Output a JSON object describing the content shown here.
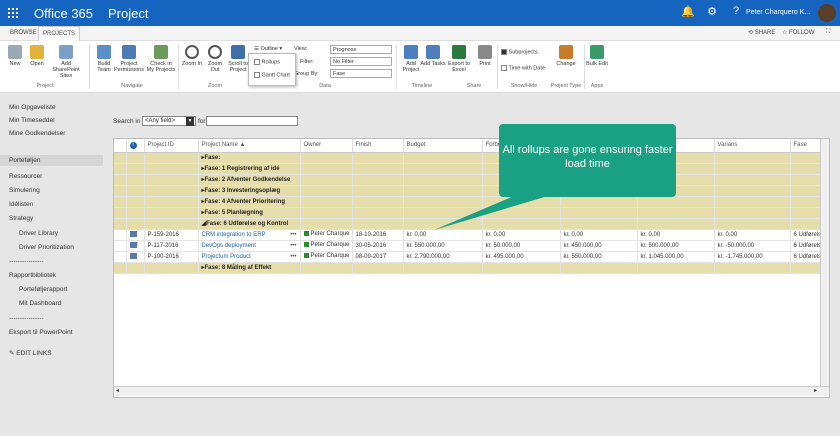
{
  "header": {
    "app": "Office 365",
    "site": "Project",
    "user": "Peter Charquero K..."
  },
  "tabs": [
    "BROWSE",
    "PROJECTS"
  ],
  "tabbar_actions": {
    "share": "SHARE",
    "follow": "FOLLOW"
  },
  "ribbon": {
    "buttons": {
      "new": "New",
      "open": "Open",
      "add_sites": "Add SharePoint Sites",
      "build_team": "Build Team",
      "permissions": "Project Permissions",
      "check_in": "Check in My Projects",
      "zoom_in": "Zoom In",
      "zoom_out": "Zoom Out",
      "scroll": "Scroll to Project",
      "add_project": "Add Project",
      "add_tasks": "Add Tasks",
      "export": "Export to Excel",
      "print": "Print",
      "change": "Change",
      "bulk_edit": "Bulk Edit"
    },
    "outline": "Outline",
    "rollups": "Rollups",
    "gantt": "Gantt Chart",
    "view_label": "View:",
    "view_value": "Prognose",
    "filter_label": "Filter:",
    "filter_value": "No Filter",
    "groupby_label": "Group By:",
    "groupby_value": "Fase",
    "subprojects": "Subprojects",
    "time_with_date": "Time with Date",
    "groups": {
      "project": "Project",
      "navigate": "Navigate",
      "zoom": "Zoom",
      "data": "Data",
      "timeline": "Timeline",
      "share": "Share",
      "showhide": "Show/Hide",
      "project_type": "Project Type",
      "apps": "Apps"
    }
  },
  "leftnav": [
    {
      "label": "Min Opgaveliste"
    },
    {
      "label": "Min Timeseddel"
    },
    {
      "label": "Mine Godkendelser"
    },
    {
      "label": "Porteføljen"
    },
    {
      "label": "Ressourcer"
    },
    {
      "label": "Simulering"
    },
    {
      "label": "Idélisten"
    },
    {
      "label": "Strategy"
    },
    {
      "label": "Driver Library"
    },
    {
      "label": "Driver Prioritization"
    },
    {
      "label": "----------------"
    },
    {
      "label": "Rapportbibliotek"
    },
    {
      "label": "Porteføljerapport"
    },
    {
      "label": "Mit Dashboard"
    },
    {
      "label": "----------------"
    },
    {
      "label": "Eksport til PowerPoint"
    },
    {
      "label": "EDIT LINKS"
    }
  ],
  "search": {
    "label": "Search in",
    "field": "<Any field>",
    "for": "for",
    "value": ""
  },
  "grid": {
    "columns": [
      "",
      "Project ID",
      "Project Name",
      "Owner",
      "Finish",
      "Budget",
      "Forbr",
      "",
      "",
      "Varians",
      "Fase"
    ],
    "phases": [
      "Fase:",
      "Fase: 1 Registrering af idé",
      "Fase: 2 Afventer Godkendelse",
      "Fase: 3 Investeringsoplæg",
      "Fase: 4 Afventer Prioritering",
      "Fase: 5 Planlægning",
      "Fase: 6 Udførelse og Kontrol",
      "Fase: 8 Måling af Effekt"
    ],
    "rows": [
      {
        "id": "P-159-2016",
        "name": "CRM integration to ERP",
        "owner": "Peter Charque",
        "finish": "18-10-2016",
        "budget": "kr. 0,00",
        "forbr": "kr. 0,00",
        "c7": "kr. 0,00",
        "c8": "kr. 0,00",
        "varians": "kr. 0,00",
        "fase": "6 Udførelse"
      },
      {
        "id": "P-117-2016",
        "name": "DevOps deployment",
        "owner": "Peter Charque",
        "finish": "30-05-2016",
        "budget": "kr. 550.000,00",
        "forbr": "kr. 50.000,00",
        "c7": "kr. 450.000,00",
        "c8": "kr. 500.000,00",
        "varians": "kr. -50.000,00",
        "fase": "6 Udførelse"
      },
      {
        "id": "P-100-2016",
        "name": "Projectum Product",
        "owner": "Peter Charque",
        "finish": "08-09-2017",
        "budget": "kr. 2.790.000,00",
        "forbr": "kr. 495.000,00",
        "c7": "kr. 550.000,00",
        "c8": "kr. 1.045.000,00",
        "varians": "kr. -1.745.000,00",
        "fase": "6 Udførelse"
      }
    ]
  },
  "callout": "All rollups are gone ensuring faster load time",
  "colors": {
    "suite_bar": "#1565c0",
    "phase_row": "#e6deaa",
    "callout": "#1aa082"
  }
}
